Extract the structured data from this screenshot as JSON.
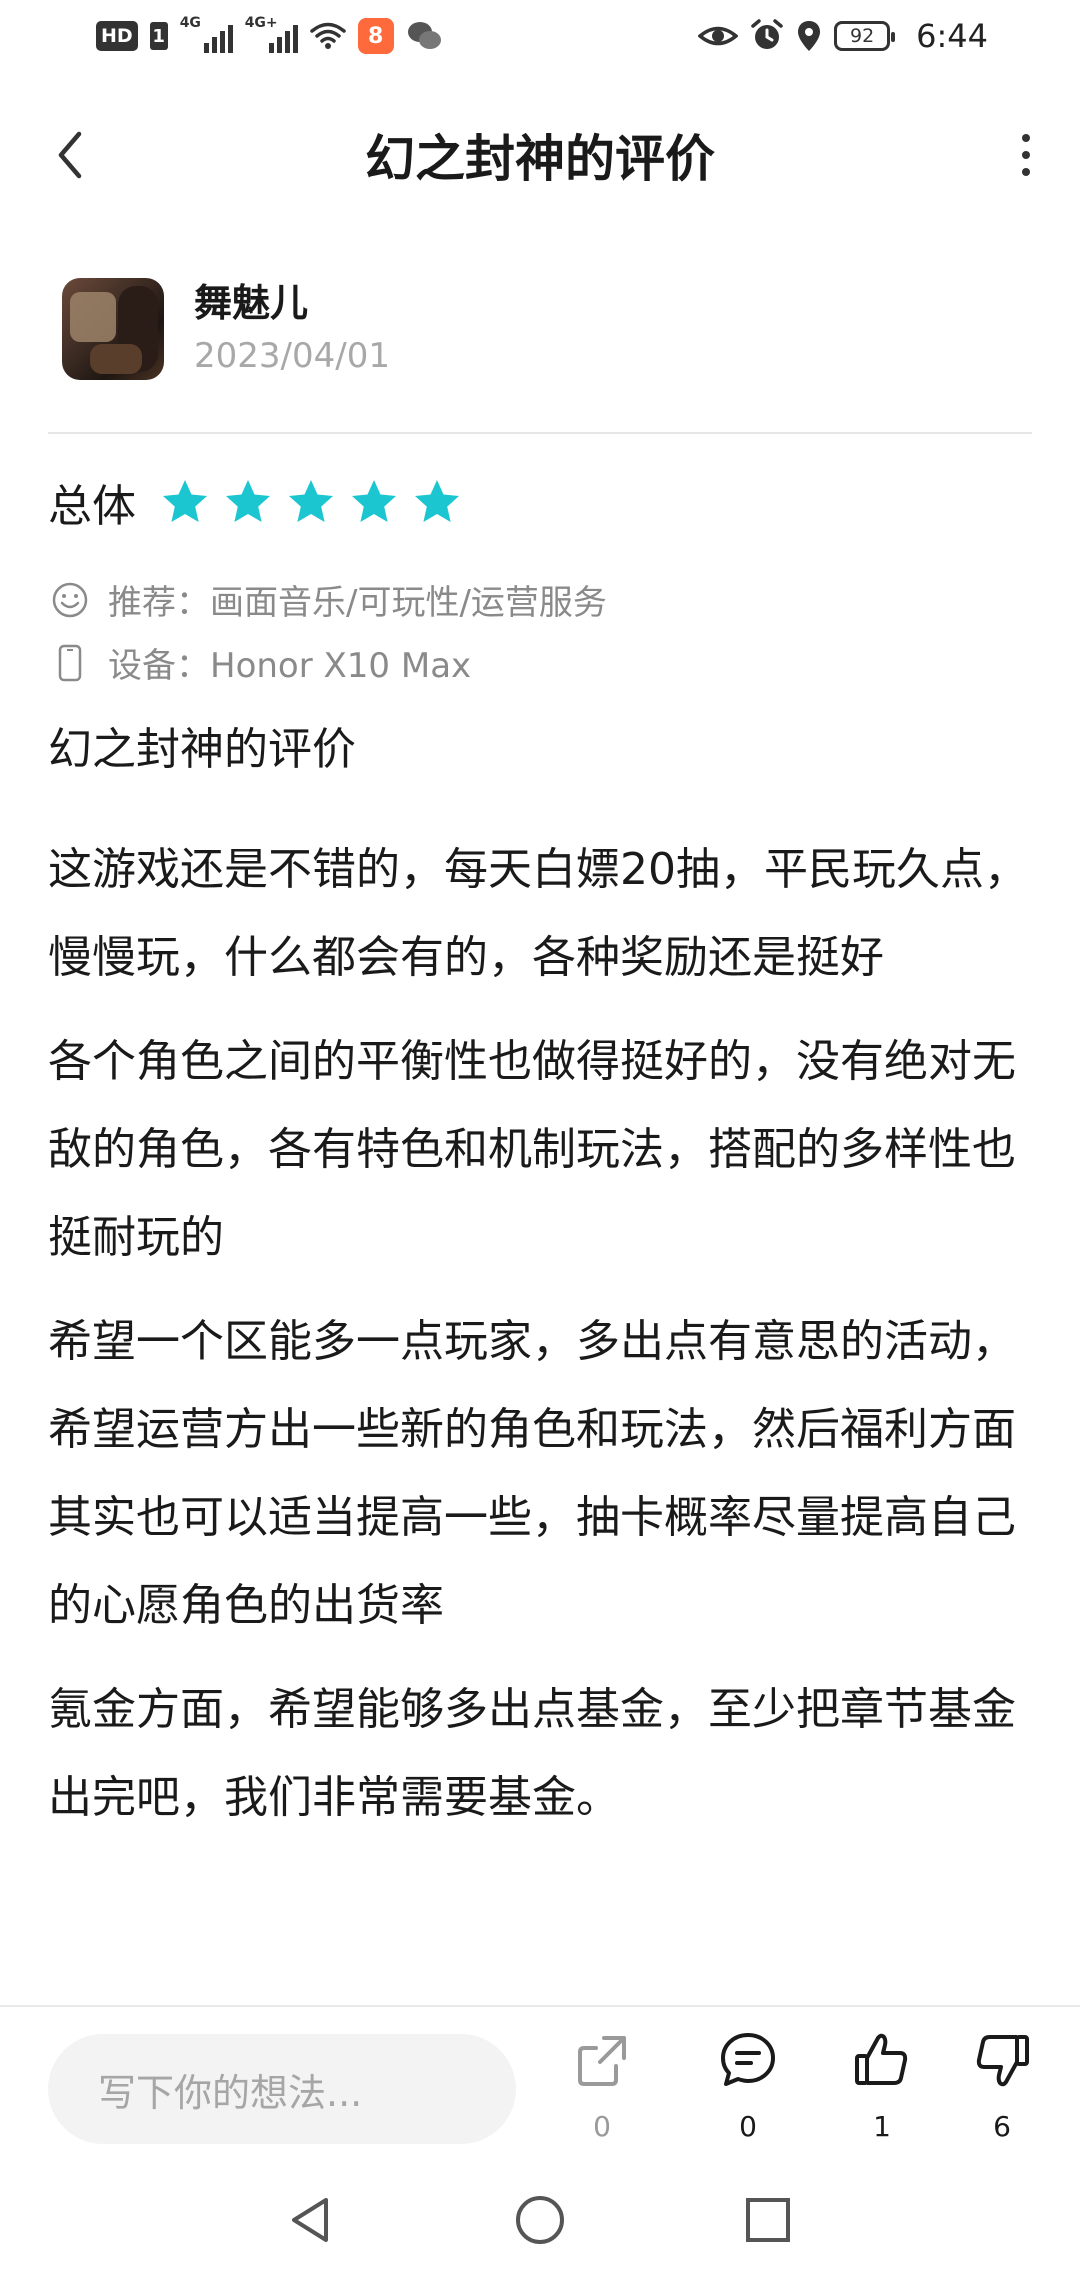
{
  "status_bar": {
    "hd": "HD",
    "sim": "1",
    "net1": "4G",
    "net2": "4G+",
    "app_badge": "8",
    "battery": "92",
    "time": "6:44"
  },
  "header": {
    "title": "幻之封神的评价"
  },
  "review": {
    "user_name": "舞魅儿",
    "date": "2023/04/01",
    "rating_label": "总体",
    "rating_value": 5,
    "rating_max": 5,
    "star_color": "#1cc6d0",
    "recommend": "推荐：画面音乐/可玩性/运营服务",
    "device": "设备：Honor X10 Max",
    "subtitle": "幻之封神的评价",
    "paragraphs": [
      "这游戏还是不错的，每天白嫖20抽，平民玩久点，慢慢玩，什么都会有的，各种奖励还是挺好",
      "各个角色之间的平衡性也做得挺好的，没有绝对无敌的角色，各有特色和机制玩法，搭配的多样性也挺耐玩的",
      "希望一个区能多一点玩家，多出点有意思的活动，希望运营方出一些新的角色和玩法，然后福利方面其实也可以适当提高一些，抽卡概率尽量提高自己的心愿角色的出货率",
      "氪金方面，希望能够多出点基金，至少把章节基金出完吧，我们非常需要基金。"
    ]
  },
  "bottom_bar": {
    "input_placeholder": "写下你的想法...",
    "share_count": "0",
    "comment_count": "0",
    "like_count": "1",
    "dislike_count": "6"
  }
}
